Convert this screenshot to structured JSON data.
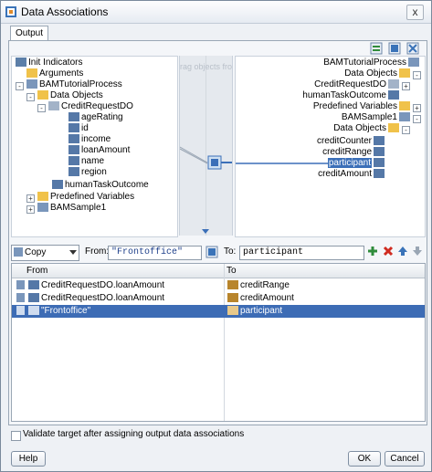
{
  "window": {
    "title": "Data Associations",
    "close_glyph": "x"
  },
  "tab": {
    "label": "Output"
  },
  "toolbar_icons": [
    "auto-map-icon",
    "expression-icon",
    "xsl-icon"
  ],
  "source_tree": {
    "drag_hint": "rag objects fro",
    "nodes": [
      {
        "label": "Init Indicators",
        "indent": 0
      },
      {
        "label": "Arguments",
        "indent": 1
      },
      {
        "label": "BAMTutorialProcess",
        "indent": 1
      },
      {
        "label": "Data Objects",
        "indent": 2
      },
      {
        "label": "CreditRequestDO",
        "indent": 3
      },
      {
        "label": "ageRating",
        "indent": 4
      },
      {
        "label": "id",
        "indent": 4
      },
      {
        "label": "income",
        "indent": 4
      },
      {
        "label": "loanAmount",
        "indent": 4
      },
      {
        "label": "name",
        "indent": 4
      },
      {
        "label": "region",
        "indent": 4
      },
      {
        "label": "humanTaskOutcome",
        "indent": 3
      },
      {
        "label": "Predefined Variables",
        "indent": 2
      },
      {
        "label": "BAMSample1",
        "indent": 2
      }
    ]
  },
  "target_tree": {
    "nodes": [
      {
        "label": "BAMTutorialProcess"
      },
      {
        "label": "Data Objects"
      },
      {
        "label": "CreditRequestDO"
      },
      {
        "label": "humanTaskOutcome"
      },
      {
        "label": "Predefined Variables"
      },
      {
        "label": "BAMSample1"
      },
      {
        "label": "Data Objects"
      },
      {
        "label": "creditCounter"
      },
      {
        "label": "creditRange"
      },
      {
        "label": "participant"
      },
      {
        "label": "creditAmount"
      }
    ],
    "selected": "participant"
  },
  "copy_bar": {
    "operation": "Copy",
    "from_label": "From:",
    "from_value": "\"Frontoffice\"",
    "to_label": "To:",
    "to_value": "participant"
  },
  "table": {
    "columns": [
      "From",
      "To"
    ],
    "rows": [
      {
        "from": "CreditRequestDO.loanAmount",
        "to": "creditRange"
      },
      {
        "from": "CreditRequestDO.loanAmount",
        "to": "creditAmount"
      },
      {
        "from": "\"Frontoffice\"",
        "to": "participant"
      }
    ],
    "selected_row": 2
  },
  "validate": {
    "label": "Validate target after assigning output data associations",
    "checked": false
  },
  "buttons": {
    "help": "Help",
    "ok": "OK",
    "cancel": "Cancel"
  }
}
